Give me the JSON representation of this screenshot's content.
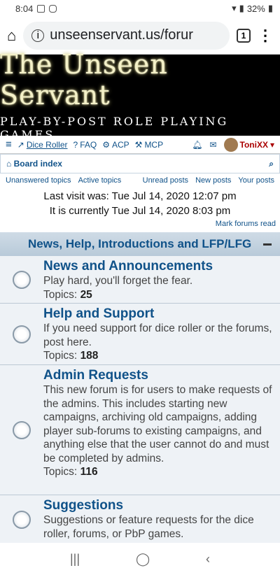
{
  "status": {
    "time": "8:04",
    "battery": "32%"
  },
  "browser": {
    "url": "unseenservant.us/forur",
    "tabs": "1"
  },
  "banner": {
    "title": "The Unseen Servant",
    "subtitle": "PLAY-BY-POST ROLE PLAYING GAMES"
  },
  "nav": {
    "dice_roller": "Dice Roller",
    "faq": "FAQ",
    "acp": "ACP",
    "mcp": "MCP",
    "username": "ToniXX",
    "board_index": "Board index"
  },
  "quicklinks": {
    "unanswered": "Unanswered topics",
    "active": "Active topics",
    "unread": "Unread posts",
    "new": "New posts",
    "your": "Your posts"
  },
  "visit": {
    "last": "Last visit was: Tue Jul 14, 2020 12:07 pm",
    "current": "It is currently Tue Jul 14, 2020 8:03 pm"
  },
  "mark_read": "Mark forums read",
  "category": {
    "title": "News, Help, Introductions and LFP/LFG"
  },
  "forums": [
    {
      "title": "News and Announcements",
      "desc": "Play hard, you'll forget the fear.",
      "topics_label": "Topics: ",
      "topics": "25"
    },
    {
      "title": "Help and Support",
      "desc": "If you need support for dice roller or the forums, post here.",
      "topics_label": "Topics: ",
      "topics": "188"
    },
    {
      "title": "Admin Requests",
      "desc": "This new forum is for users to make requests of the admins. This includes starting new campaigns, archiving old campaigns, adding player sub-forums to existing campaigns, and anything else that the user cannot do and must be completed by admins.",
      "topics_label": "Topics: ",
      "topics": "116"
    },
    {
      "title": "Suggestions",
      "desc": "Suggestions or feature requests for the dice roller, forums, or PbP games.",
      "topics_label": "",
      "topics": ""
    }
  ]
}
